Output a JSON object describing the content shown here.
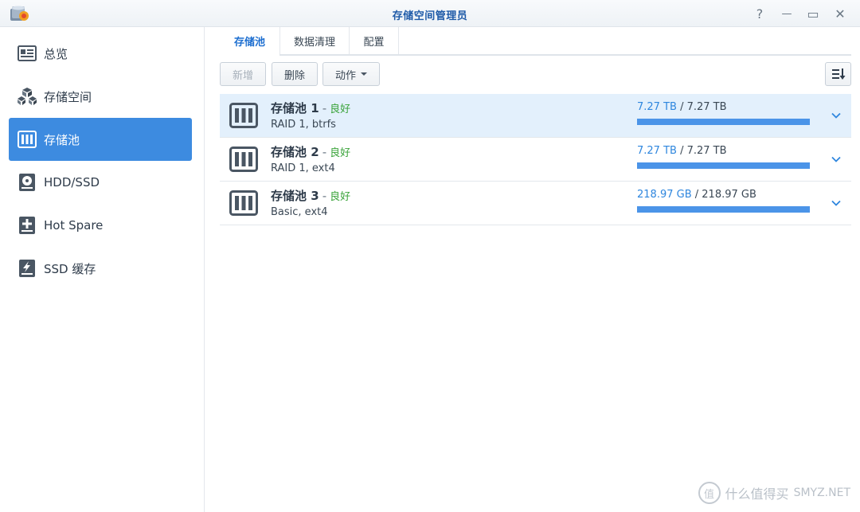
{
  "window": {
    "title": "存储空间管理员",
    "help_glyph": "?",
    "minimize_glyph": "—",
    "maximize_glyph": "▭",
    "close_glyph": "✕"
  },
  "sidebar": {
    "items": [
      {
        "label": "总览",
        "icon": "overview-icon"
      },
      {
        "label": "存储空间",
        "icon": "cubes-icon"
      },
      {
        "label": "存储池",
        "icon": "storage-pool-icon",
        "active": true
      },
      {
        "label": "HDD/SSD",
        "icon": "disk-icon"
      },
      {
        "label": "Hot Spare",
        "icon": "hot-spare-icon"
      },
      {
        "label": "SSD 缓存",
        "icon": "ssd-cache-icon"
      }
    ]
  },
  "tabs": [
    {
      "label": "存储池",
      "active": true
    },
    {
      "label": "数据清理"
    },
    {
      "label": "配置"
    }
  ],
  "toolbar": {
    "add_label": "新增",
    "delete_label": "删除",
    "action_label": "动作"
  },
  "pools": [
    {
      "name": "存储池",
      "num": "1",
      "sep": "-",
      "status": "良好",
      "sub": "RAID 1, btrfs",
      "used": "7.27 TB",
      "total": "/ 7.27 TB",
      "fill": 1.0,
      "selected": true
    },
    {
      "name": "存储池",
      "num": "2",
      "sep": "-",
      "status": "良好",
      "sub": "RAID 1, ext4",
      "used": "7.27 TB",
      "total": "/ 7.27 TB",
      "fill": 1.0
    },
    {
      "name": "存储池",
      "num": "3",
      "sep": "-",
      "status": "良好",
      "sub": "Basic, ext4",
      "used": "218.97 GB",
      "total": "/ 218.97 GB",
      "fill": 1.0
    }
  ],
  "watermark": {
    "mark": "值",
    "text": "什么值得买",
    "site": "SMYZ.NET"
  },
  "colors": {
    "accent": "#3d8be0",
    "status_good": "#3aa33a",
    "bar_fill": "#4b94e8"
  }
}
